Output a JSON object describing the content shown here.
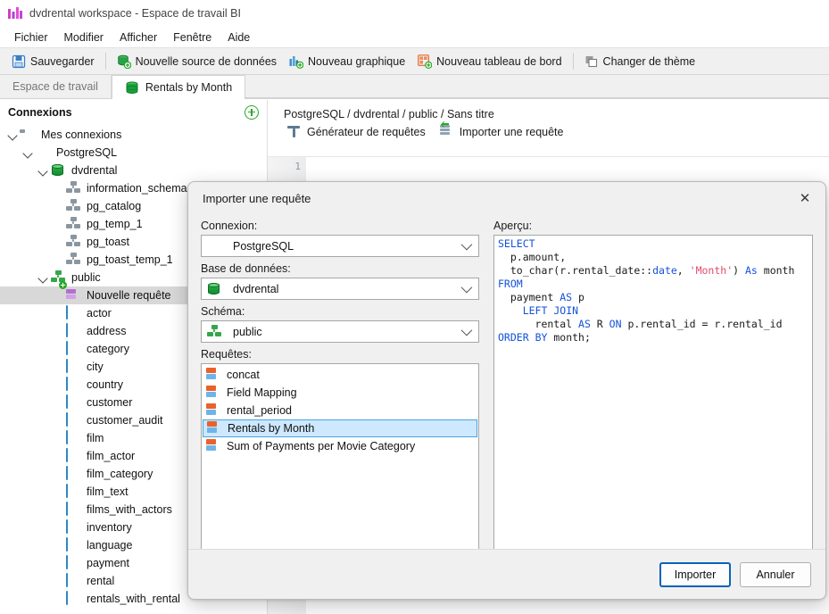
{
  "window": {
    "title": "dvdrental workspace - Espace de travail BI",
    "app_icon": "bar-chart-icon"
  },
  "menubar": {
    "items": [
      {
        "label": "Fichier"
      },
      {
        "label": "Modifier"
      },
      {
        "label": "Afficher"
      },
      {
        "label": "Fenêtre"
      },
      {
        "label": "Aide"
      }
    ]
  },
  "toolbar": {
    "buttons": [
      {
        "label": "Sauvegarder",
        "icon": "save-icon"
      },
      {
        "label": "Nouvelle source de données",
        "icon": "new-datasource-icon"
      },
      {
        "label": "Nouveau graphique",
        "icon": "new-chart-icon"
      },
      {
        "label": "Nouveau tableau de bord",
        "icon": "new-dashboard-icon"
      },
      {
        "label": "Changer de thème",
        "icon": "theme-icon"
      }
    ]
  },
  "tabs": [
    {
      "label": "Espace de travail",
      "active": false,
      "icon": null
    },
    {
      "label": "Rentals by Month",
      "active": true,
      "icon": "database-icon"
    }
  ],
  "sidebar": {
    "title": "Connexions",
    "add_button": "add-connection-icon",
    "tree": [
      {
        "label": "Mes connexions",
        "indent": 0,
        "icon": "plug-icon",
        "expander": "open",
        "selected": false
      },
      {
        "label": "PostgreSQL",
        "indent": 1,
        "icon": "postgres-icon",
        "expander": "open",
        "selected": false
      },
      {
        "label": "dvdrental",
        "indent": 2,
        "icon": "database-icon",
        "expander": "open",
        "selected": false
      },
      {
        "label": "information_schema",
        "indent": 3,
        "icon": "schema-gray-icon",
        "expander": "none",
        "selected": false
      },
      {
        "label": "pg_catalog",
        "indent": 3,
        "icon": "schema-gray-icon",
        "expander": "none",
        "selected": false
      },
      {
        "label": "pg_temp_1",
        "indent": 3,
        "icon": "schema-gray-icon",
        "expander": "none",
        "selected": false
      },
      {
        "label": "pg_toast",
        "indent": 3,
        "icon": "schema-gray-icon",
        "expander": "none",
        "selected": false
      },
      {
        "label": "pg_toast_temp_1",
        "indent": 3,
        "icon": "schema-gray-icon",
        "expander": "none",
        "selected": false
      },
      {
        "label": "public",
        "indent": 2,
        "icon": "schema-green-icon",
        "expander": "open",
        "selected": false
      },
      {
        "label": "Nouvelle requête",
        "indent": 3,
        "icon": "new-query-icon",
        "expander": "none",
        "selected": true
      },
      {
        "label": "actor",
        "indent": 3,
        "icon": "table-icon",
        "expander": "none",
        "selected": false
      },
      {
        "label": "address",
        "indent": 3,
        "icon": "table-icon",
        "expander": "none",
        "selected": false
      },
      {
        "label": "category",
        "indent": 3,
        "icon": "table-icon",
        "expander": "none",
        "selected": false
      },
      {
        "label": "city",
        "indent": 3,
        "icon": "table-icon",
        "expander": "none",
        "selected": false
      },
      {
        "label": "country",
        "indent": 3,
        "icon": "table-icon",
        "expander": "none",
        "selected": false
      },
      {
        "label": "customer",
        "indent": 3,
        "icon": "table-icon",
        "expander": "none",
        "selected": false
      },
      {
        "label": "customer_audit",
        "indent": 3,
        "icon": "table-icon",
        "expander": "none",
        "selected": false
      },
      {
        "label": "film",
        "indent": 3,
        "icon": "table-icon",
        "expander": "none",
        "selected": false
      },
      {
        "label": "film_actor",
        "indent": 3,
        "icon": "table-icon",
        "expander": "none",
        "selected": false
      },
      {
        "label": "film_category",
        "indent": 3,
        "icon": "table-icon",
        "expander": "none",
        "selected": false
      },
      {
        "label": "film_text",
        "indent": 3,
        "icon": "table-icon",
        "expander": "none",
        "selected": false
      },
      {
        "label": "films_with_actors",
        "indent": 3,
        "icon": "table-icon",
        "expander": "none",
        "selected": false
      },
      {
        "label": "inventory",
        "indent": 3,
        "icon": "table-icon",
        "expander": "none",
        "selected": false
      },
      {
        "label": "language",
        "indent": 3,
        "icon": "table-icon",
        "expander": "none",
        "selected": false
      },
      {
        "label": "payment",
        "indent": 3,
        "icon": "table-icon",
        "expander": "none",
        "selected": false
      },
      {
        "label": "rental",
        "indent": 3,
        "icon": "table-icon",
        "expander": "none",
        "selected": false
      },
      {
        "label": "rentals_with_rental",
        "indent": 3,
        "icon": "table-icon",
        "expander": "none",
        "selected": false
      }
    ]
  },
  "main": {
    "breadcrumb": "PostgreSQL / dvdrental / public / Sans titre",
    "actions": [
      {
        "label": "Générateur de requêtes",
        "icon": "query-builder-icon"
      },
      {
        "label": "Importer une requête",
        "icon": "import-query-icon"
      }
    ],
    "editor": {
      "line_number": "1",
      "content": ""
    }
  },
  "dialog": {
    "title": "Importer une requête",
    "close_icon": "close-icon",
    "fields": {
      "connection_label": "Connexion:",
      "connection_value": "PostgreSQL",
      "connection_icon": "postgres-icon",
      "database_label": "Base de données:",
      "database_value": "dvdrental",
      "database_icon": "database-icon",
      "schema_label": "Schéma:",
      "schema_value": "public",
      "schema_icon": "schema-green-icon",
      "queries_label": "Requêtes:"
    },
    "queries": [
      {
        "label": "concat",
        "selected": false
      },
      {
        "label": "Field Mapping",
        "selected": false
      },
      {
        "label": "rental_period",
        "selected": false
      },
      {
        "label": "Rentals by Month",
        "selected": true
      },
      {
        "label": "Sum of Payments per Movie Category",
        "selected": false
      }
    ],
    "preview_label": "Aperçu:",
    "preview_sql_lines": [
      "SELECT",
      "  p.amount,",
      "  to_char(r.rental_date::date, 'Month') As month",
      "FROM",
      "  payment AS p",
      "    LEFT JOIN",
      "      rental AS R ON p.rental_id = r.rental_id",
      "ORDER BY month;"
    ],
    "buttons": {
      "import_label": "Importer",
      "cancel_label": "Annuler"
    }
  },
  "colors": {
    "accent_blue": "#0a63b8",
    "selection_blue": "#cde8ff",
    "keyword": "#1352d8",
    "string": "#e24b6b",
    "green": "#2aa829",
    "orange": "#e8622a",
    "magenta": "#d63bc4"
  }
}
